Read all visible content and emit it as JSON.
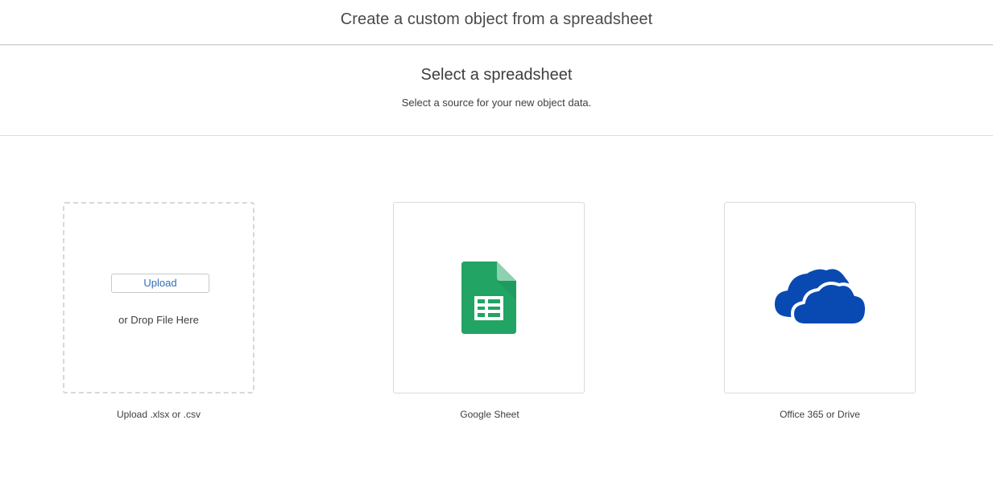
{
  "header": {
    "title": "Create a custom object from a spreadsheet"
  },
  "step": {
    "title": "Select a spreadsheet",
    "subtitle": "Select a source for your new object data."
  },
  "sources": {
    "upload": {
      "button_label": "Upload",
      "drop_text": "or Drop File Here",
      "caption": "Upload .xlsx or .csv"
    },
    "google": {
      "icon": "google-sheets-icon",
      "caption": "Google Sheet",
      "color": "#21a464"
    },
    "office": {
      "icon": "onedrive-cloud-icon",
      "caption": "Office 365 or Drive",
      "color": "#094ab2"
    }
  }
}
